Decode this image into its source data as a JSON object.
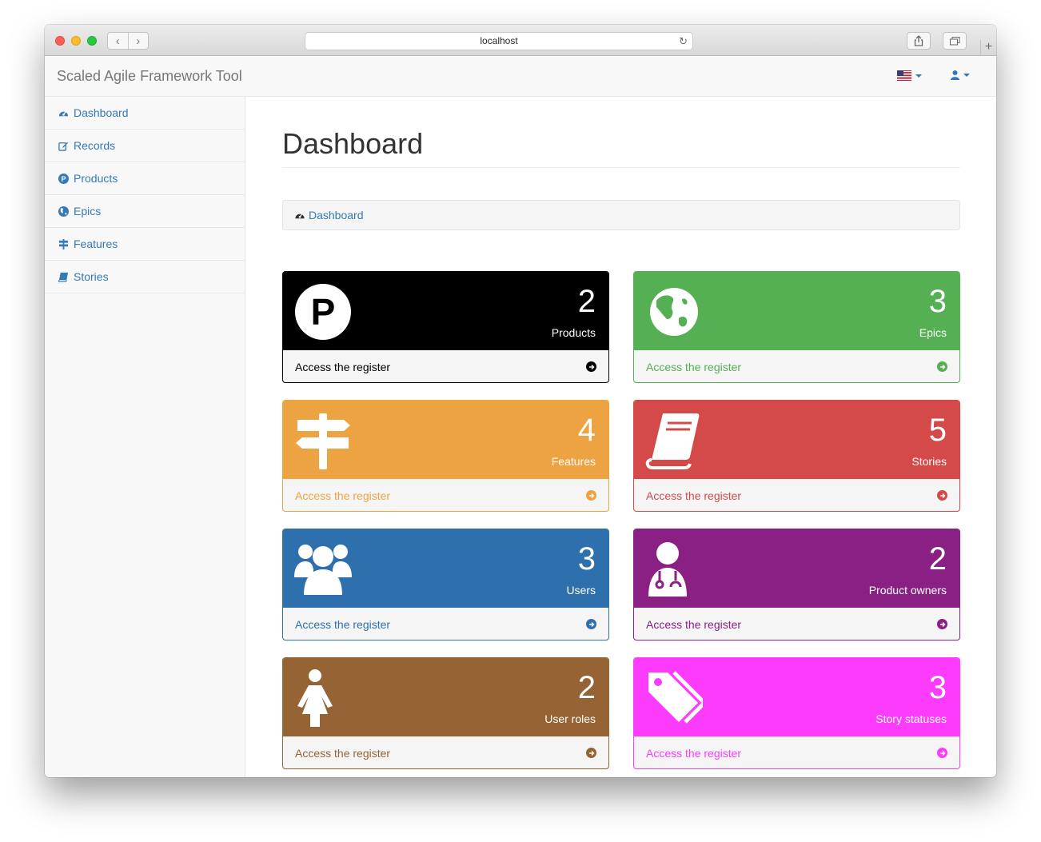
{
  "browser": {
    "url": "localhost"
  },
  "app": {
    "brand": "Scaled Agile Framework Tool"
  },
  "sidebar": {
    "items": [
      {
        "label": "Dashboard",
        "icon": "dashboard-icon"
      },
      {
        "label": "Records",
        "icon": "edit-icon"
      },
      {
        "label": "Products",
        "icon": "product-p-icon"
      },
      {
        "label": "Epics",
        "icon": "globe-icon"
      },
      {
        "label": "Features",
        "icon": "signpost-icon"
      },
      {
        "label": "Stories",
        "icon": "book-icon"
      }
    ]
  },
  "main": {
    "title": "Dashboard",
    "breadcrumb": "Dashboard"
  },
  "panels": [
    {
      "count": "2",
      "label": "Products",
      "footer": "Access the register",
      "color": "#000000",
      "icon": "product-p-icon"
    },
    {
      "count": "3",
      "label": "Epics",
      "footer": "Access the register",
      "color": "#54b052",
      "icon": "globe-icon"
    },
    {
      "count": "4",
      "label": "Features",
      "footer": "Access the register",
      "color": "#eea343",
      "icon": "signpost-icon"
    },
    {
      "count": "5",
      "label": "Stories",
      "footer": "Access the register",
      "color": "#d44a48",
      "icon": "book-icon"
    },
    {
      "count": "3",
      "label": "Users",
      "footer": "Access the register",
      "color": "#2e6fad",
      "icon": "users-icon"
    },
    {
      "count": "2",
      "label": "Product owners",
      "footer": "Access the register",
      "color": "#8a1f84",
      "icon": "user-md-icon"
    },
    {
      "count": "2",
      "label": "User roles",
      "footer": "Access the register",
      "color": "#956334",
      "icon": "female-icon"
    },
    {
      "count": "3",
      "label": "Story statuses",
      "footer": "Access the register",
      "color": "#fd3bfc",
      "icon": "tags-icon"
    }
  ]
}
